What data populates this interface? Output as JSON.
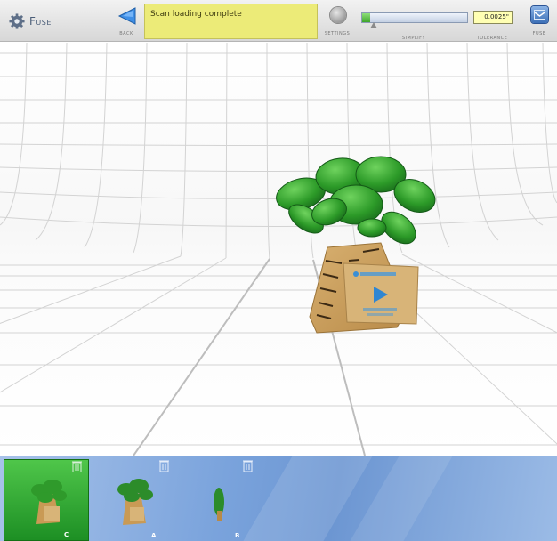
{
  "app": {
    "title": "Fuse"
  },
  "toolbar": {
    "back_label": "Back",
    "status_text": "Scan loading complete",
    "settings_label": "Settings",
    "simplify_label": "Simplify",
    "simplify_level": 0.08,
    "tolerance_label": "Tolerance",
    "tolerance_value": "0.0025\"",
    "fuse_label": "Fuse"
  },
  "scans": [
    {
      "label": "C",
      "selected": true
    },
    {
      "label": "A",
      "selected": false
    },
    {
      "label": "B",
      "selected": false
    }
  ],
  "colors": {
    "status_bg": "#eceb78",
    "active_thumb": "#2aa82f",
    "strip_bg": "#7aa3dc",
    "foliage": "#2e9b2a",
    "trunk": "#c99a55"
  }
}
